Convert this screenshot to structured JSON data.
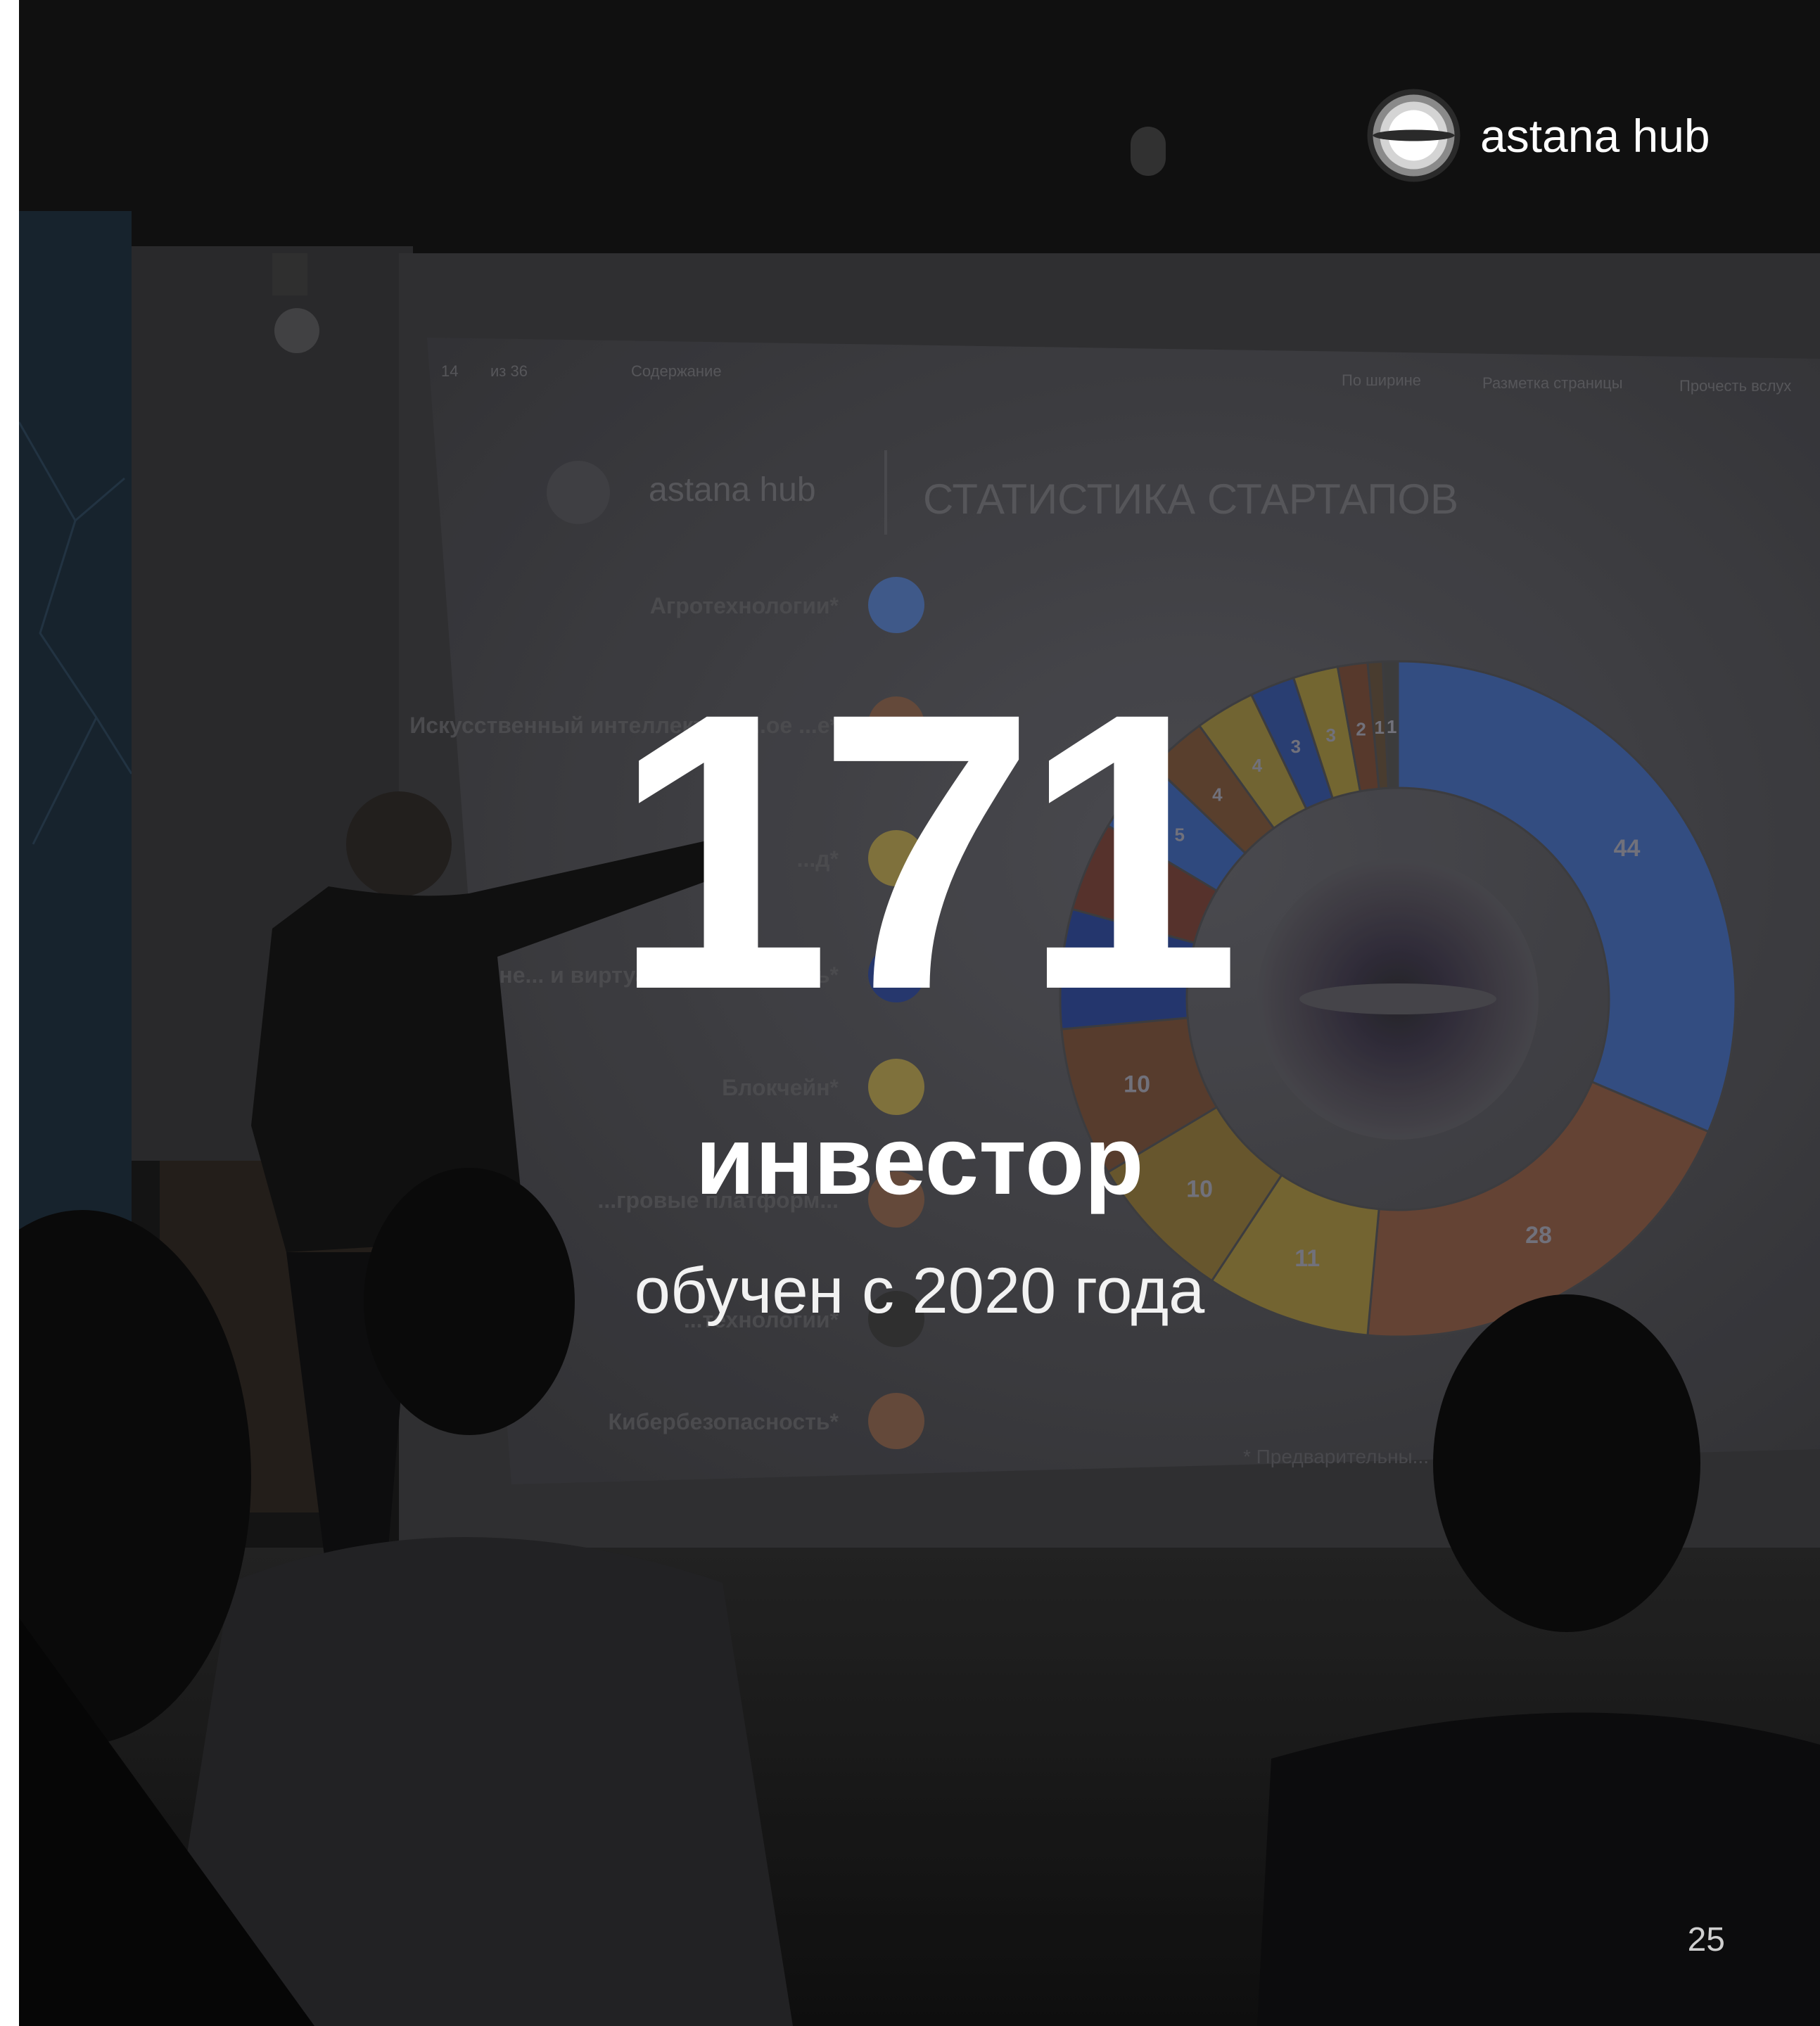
{
  "brand": {
    "name": "astana hub",
    "logo_icon": "astana-hub-logo-icon"
  },
  "stat": {
    "number": "171",
    "label": "инвестор",
    "subtitle": "обучен с 2020 года"
  },
  "page_number": "25",
  "screen": {
    "toolbar": {
      "page": "14",
      "of": "из 36",
      "contents": "Содержание",
      "fit_width": "По ширине",
      "page_layout": "Разметка страницы",
      "read_aloud": "Прочесть вслух"
    },
    "slide_brand": "astana hub",
    "slide_title": "СТАТИСТИКА СТАРТАПОВ",
    "legend": [
      {
        "label": "Агротехнологии*",
        "color": "#4d6da8"
      },
      {
        "label": "Искусственный интеллект и м...ое ...е*",
        "color": "#7b5a47"
      },
      {
        "label": "...д*",
        "color": "#9c8a4a"
      },
      {
        "label": "Дополне... и виртуа...ая реальность*",
        "color": "#2f4486"
      },
      {
        "label": "Блокчейн*",
        "color": "#9c8a4a"
      },
      {
        "label": "...гровые платформ...",
        "color": "#7b5a47"
      },
      {
        "label": "...технологии*",
        "color": "#3a3a3a"
      },
      {
        "label": "Кибербезопасность*",
        "color": "#7b5a47"
      }
    ],
    "footnote": "* Предварительны..."
  },
  "chart_data": {
    "type": "pie",
    "title": "СТАТИСТИКА СТАРТАПОВ",
    "values": [
      44,
      28,
      11,
      10,
      10,
      8,
      6,
      5,
      4,
      4,
      3,
      3,
      2,
      1,
      1
    ],
    "labels": [
      "44",
      "28",
      "11",
      "10",
      "10",
      "",
      "",
      "5",
      "4",
      "4",
      "3",
      "3",
      "2",
      "1",
      "1"
    ],
    "colors": [
      "#3f5f9e",
      "#7a5240",
      "#8d7b3c",
      "#7e6a38",
      "#6b4a38",
      "#2d4386",
      "#6a3e36",
      "#3a5a9a",
      "#6d4d37",
      "#8a7a3d",
      "#334c8c",
      "#8d7d3c",
      "#6b4636",
      "#5a4a3a",
      "#4a4a4a"
    ]
  }
}
